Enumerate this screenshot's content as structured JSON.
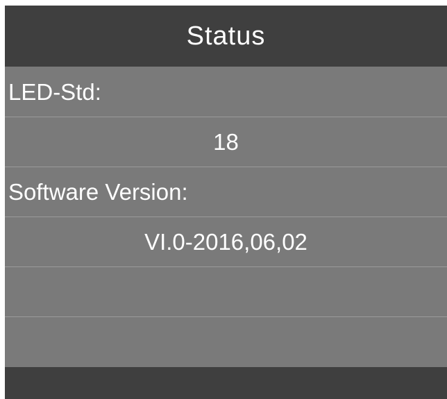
{
  "header": {
    "title": "Status"
  },
  "rows": [
    {
      "text": "LED-Std:"
    },
    {
      "text": "18"
    },
    {
      "text": "Software Version:"
    },
    {
      "text": "VI.0-2016,06,02"
    },
    {
      "text": ""
    },
    {
      "text": ""
    }
  ],
  "colors": {
    "header_bg": "#3f3f3f",
    "row_bg": "#7a7a7a",
    "divider": "#9a9a9a",
    "text": "#ffffff"
  }
}
